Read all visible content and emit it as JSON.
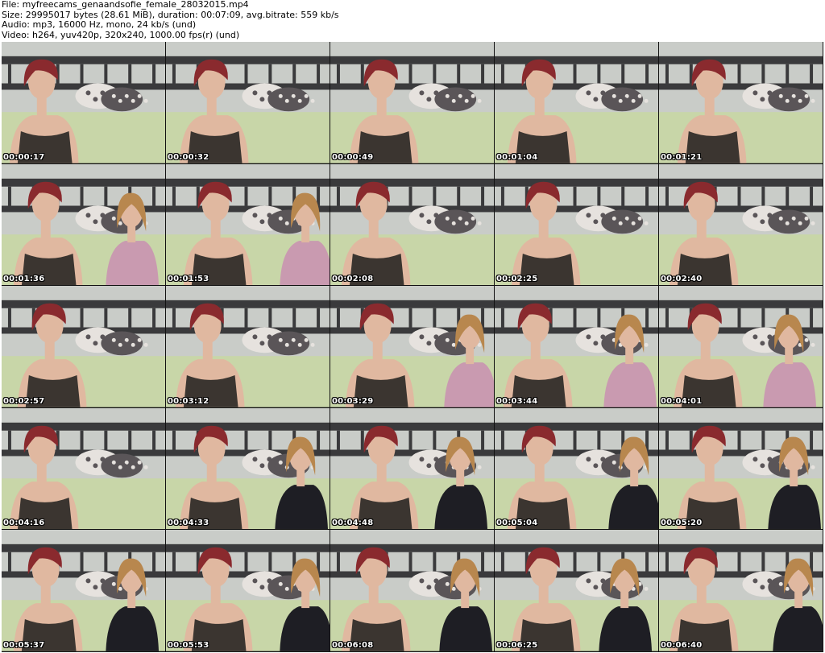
{
  "header": {
    "file_line": "File: myfreecams_genaandsofie_female_28032015.mp4",
    "size_line": "Size: 29995017 bytes (28.61 MiB), duration: 00:07:09, avg.bitrate: 559 kb/s",
    "audio_line": "Audio: mp3, 16000 Hz, mono, 24 kb/s (und)",
    "video_line": "Video: h264, yuv420p, 320x240, 1000.00 fps(r) (und)"
  },
  "thumbnails": [
    {
      "timestamp": "00:00:17",
      "second_person": false
    },
    {
      "timestamp": "00:00:32",
      "second_person": false
    },
    {
      "timestamp": "00:00:49",
      "second_person": false
    },
    {
      "timestamp": "00:01:04",
      "second_person": false
    },
    {
      "timestamp": "00:01:21",
      "second_person": false
    },
    {
      "timestamp": "00:01:36",
      "second_person": true
    },
    {
      "timestamp": "00:01:53",
      "second_person": true
    },
    {
      "timestamp": "00:02:08",
      "second_person": false
    },
    {
      "timestamp": "00:02:25",
      "second_person": false
    },
    {
      "timestamp": "00:02:40",
      "second_person": false
    },
    {
      "timestamp": "00:02:57",
      "second_person": false
    },
    {
      "timestamp": "00:03:12",
      "second_person": false
    },
    {
      "timestamp": "00:03:29",
      "second_person": true
    },
    {
      "timestamp": "00:03:44",
      "second_person": true
    },
    {
      "timestamp": "00:04:01",
      "second_person": true
    },
    {
      "timestamp": "00:04:16",
      "second_person": false
    },
    {
      "timestamp": "00:04:33",
      "second_person": true
    },
    {
      "timestamp": "00:04:48",
      "second_person": true
    },
    {
      "timestamp": "00:05:04",
      "second_person": true
    },
    {
      "timestamp": "00:05:20",
      "second_person": true
    },
    {
      "timestamp": "00:05:37",
      "second_person": true
    },
    {
      "timestamp": "00:05:53",
      "second_person": true
    },
    {
      "timestamp": "00:06:08",
      "second_person": true
    },
    {
      "timestamp": "00:06:25",
      "second_person": true
    },
    {
      "timestamp": "00:06:40",
      "second_person": true
    }
  ],
  "colors": {
    "wall": "#c9ccc8",
    "headboard": "#3a3a3c",
    "bedsheet": "#c8d6a8",
    "pillow_light": "#e6e2de",
    "pillow_dark": "#5a5558",
    "hair_red": "#8a2a2e",
    "hair_blonde": "#b8874e",
    "skin": "#e0b8a0",
    "dress": "#3b3530",
    "top_pink": "#c99ab0",
    "top_black": "#1e1e24"
  }
}
